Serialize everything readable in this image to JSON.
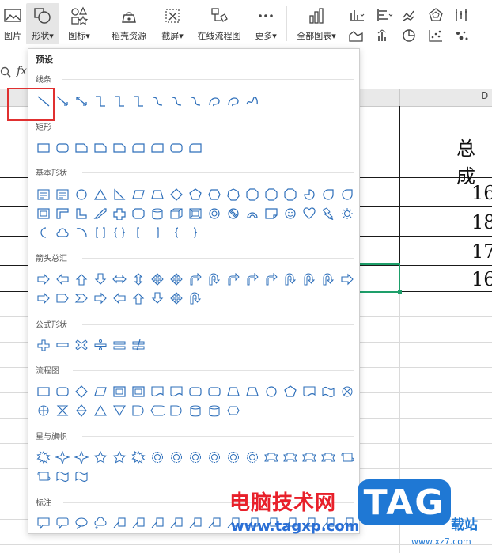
{
  "toolbar": {
    "picture_label": "图片",
    "shape_label": "形状",
    "icon_label": "图标",
    "resource_label": "稻壳资源",
    "screenshot_label": "截屏",
    "flowchart_label": "在线流程图",
    "more_label": "更多",
    "allcharts_label": "全部图表"
  },
  "formula": {
    "fx": "fx"
  },
  "sheet": {
    "col_d": "D",
    "header_cell": "总成",
    "values": [
      "16",
      "18",
      "17",
      "16"
    ]
  },
  "panel": {
    "title": "预设",
    "sections": {
      "lines": "线条",
      "rects": "矩形",
      "basic": "基本形状",
      "arrows": "箭头总汇",
      "formula": "公式形状",
      "flow": "流程图",
      "stars": "星与旗帜",
      "callouts": "标注"
    }
  },
  "watermark": {
    "brand_cn": "电脑技术网",
    "brand_url": "www.tagxp.com",
    "tag": "TAG",
    "site_cn": "载站",
    "site_url": "www.xz7.com"
  },
  "colors": {
    "accent_green": "#1e9f6a",
    "highlight_red": "#e03030",
    "shape_stroke": "#2e6fba"
  }
}
